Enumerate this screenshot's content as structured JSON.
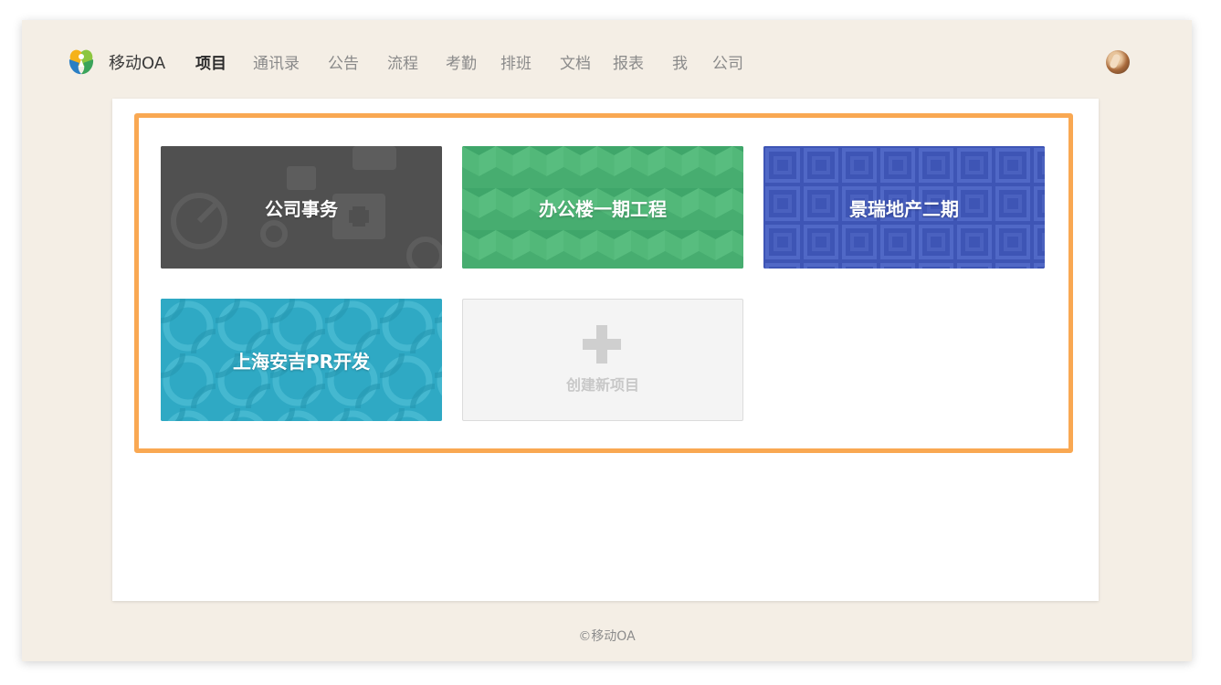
{
  "app": {
    "name": "移动OA",
    "logo_icon": "leaf-logo-icon"
  },
  "nav": [
    {
      "label": "项目",
      "active": true
    },
    {
      "label": "通讯录",
      "active": false
    },
    {
      "label": "公告",
      "active": false
    },
    {
      "label": "流程",
      "active": false
    },
    {
      "label": "考勤",
      "active": false
    },
    {
      "label": "排班",
      "active": false
    },
    {
      "label": "文档",
      "active": false
    },
    {
      "label": "报表",
      "active": false
    },
    {
      "label": "我",
      "active": false
    },
    {
      "label": "公司",
      "active": false
    }
  ],
  "projects": [
    {
      "title": "公司事务",
      "color": "#505050",
      "pattern": "office-icons"
    },
    {
      "title": "办公楼一期工程",
      "color": "#3fa66a",
      "pattern": "chevrons"
    },
    {
      "title": "景瑞地产二期",
      "color": "#3e55b5",
      "pattern": "squares"
    },
    {
      "title": "上海安吉PR开发",
      "color": "#2fa9c4",
      "pattern": "circles"
    }
  ],
  "new_project": {
    "label": "创建新项目",
    "icon": "plus-icon"
  },
  "footer": {
    "text": "©移动OA"
  },
  "colors": {
    "highlight": "#f9a852",
    "background": "#f4eee5"
  }
}
